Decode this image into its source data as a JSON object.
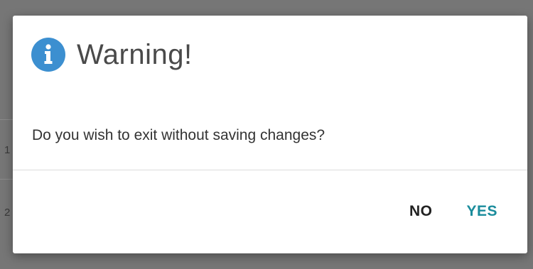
{
  "background": {
    "row_numbers": [
      "1",
      "2"
    ]
  },
  "dialog": {
    "icon": "info-icon",
    "title": "Warning!",
    "message": "Do you wish to exit without saving changes?",
    "buttons": {
      "no_label": "NO",
      "yes_label": "YES"
    },
    "colors": {
      "icon_bg": "#3c8fd0",
      "yes_text": "#1a8c9c"
    }
  }
}
